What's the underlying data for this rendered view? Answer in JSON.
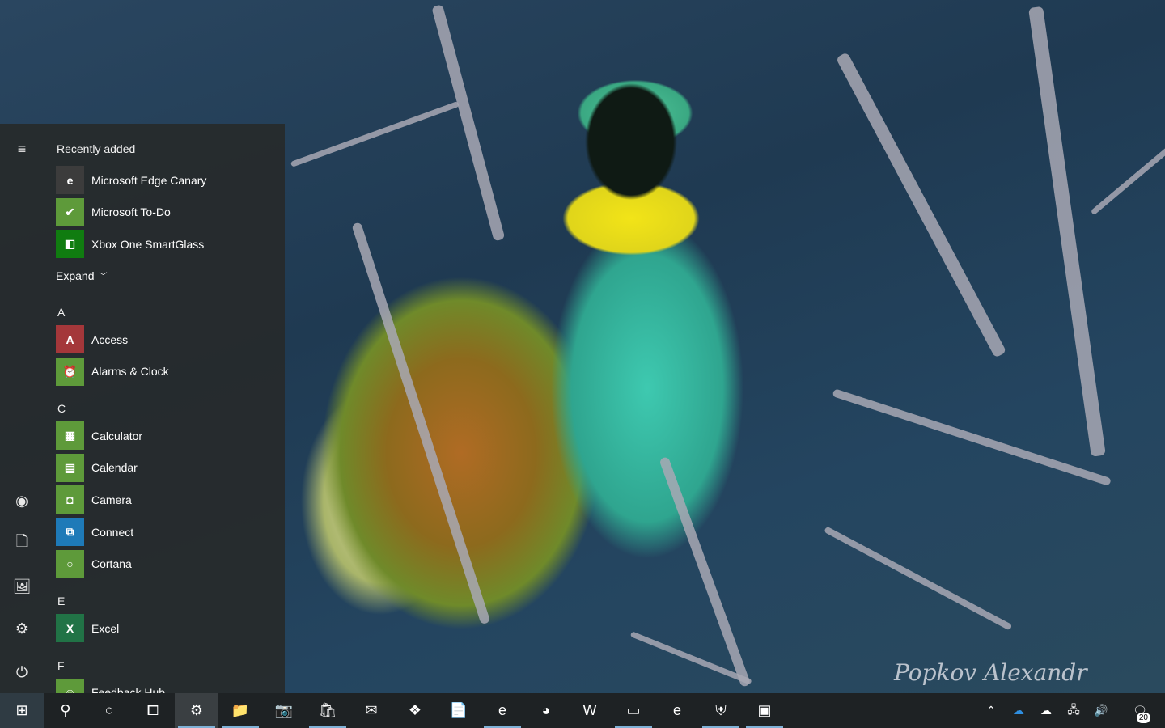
{
  "wallpaper": {
    "watermark": "Popkov Alexandr"
  },
  "start_menu": {
    "rail": {
      "items": [
        {
          "name": "hamburger-menu-icon",
          "glyph": "≡"
        },
        {
          "name": "user-avatar-icon",
          "glyph": "◉"
        },
        {
          "name": "documents-icon",
          "glyph": "🗋"
        },
        {
          "name": "pictures-icon",
          "glyph": "🖼"
        },
        {
          "name": "settings-gear-icon",
          "glyph": "⚙"
        },
        {
          "name": "power-icon",
          "glyph": "⏻"
        }
      ]
    },
    "recently_added_label": "Recently added",
    "recently_added": [
      {
        "label": "Microsoft Edge Canary",
        "icon": "edge-canary-icon",
        "color": "#3c3c3c",
        "glyph": "e"
      },
      {
        "label": "Microsoft To-Do",
        "icon": "todo-check-icon",
        "color": "#5e9a3a",
        "glyph": "✔"
      },
      {
        "label": "Xbox One SmartGlass",
        "icon": "xbox-smartglass-icon",
        "color": "#107c10",
        "glyph": "◧"
      }
    ],
    "expand_label": "Expand",
    "sections": [
      {
        "letter": "A",
        "apps": [
          {
            "label": "Access",
            "icon": "access-icon",
            "color": "#a4373a",
            "glyph": "A"
          },
          {
            "label": "Alarms & Clock",
            "icon": "alarm-clock-icon",
            "color": "#5e9a3a",
            "glyph": "⏰"
          }
        ]
      },
      {
        "letter": "C",
        "apps": [
          {
            "label": "Calculator",
            "icon": "calculator-icon",
            "color": "#5e9a3a",
            "glyph": "▦"
          },
          {
            "label": "Calendar",
            "icon": "calendar-icon",
            "color": "#5e9a3a",
            "glyph": "▤"
          },
          {
            "label": "Camera",
            "icon": "camera-icon",
            "color": "#5e9a3a",
            "glyph": "◘"
          },
          {
            "label": "Connect",
            "icon": "connect-icon",
            "color": "#1e7ab8",
            "glyph": "⧉"
          },
          {
            "label": "Cortana",
            "icon": "cortana-icon",
            "color": "#5e9a3a",
            "glyph": "○"
          }
        ]
      },
      {
        "letter": "E",
        "apps": [
          {
            "label": "Excel",
            "icon": "excel-icon",
            "color": "#217346",
            "glyph": "X"
          }
        ]
      },
      {
        "letter": "F",
        "apps": [
          {
            "label": "Feedback Hub",
            "icon": "feedback-hub-icon",
            "color": "#5e9a3a",
            "glyph": "☺"
          }
        ]
      }
    ]
  },
  "taskbar": {
    "items": [
      {
        "name": "start-button",
        "glyph": "⊞",
        "state": "start"
      },
      {
        "name": "search-icon",
        "glyph": "⚲",
        "state": ""
      },
      {
        "name": "cortana-circle-icon",
        "glyph": "○",
        "state": ""
      },
      {
        "name": "task-view-icon",
        "glyph": "⧠",
        "state": ""
      },
      {
        "name": "settings-app-icon",
        "glyph": "⚙",
        "state": "active"
      },
      {
        "name": "file-explorer-icon",
        "glyph": "📁",
        "state": "running"
      },
      {
        "name": "camera-app-icon",
        "glyph": "📷",
        "state": ""
      },
      {
        "name": "store-icon",
        "glyph": "🛍",
        "state": "running"
      },
      {
        "name": "mail-icon",
        "glyph": "✉",
        "state": ""
      },
      {
        "name": "teams-icon",
        "glyph": "❖",
        "state": ""
      },
      {
        "name": "notepad-icon",
        "glyph": "📄",
        "state": ""
      },
      {
        "name": "edge-dev-icon",
        "glyph": "e",
        "state": "running"
      },
      {
        "name": "chrome-icon",
        "glyph": "◕",
        "state": ""
      },
      {
        "name": "word-icon",
        "glyph": "W",
        "state": ""
      },
      {
        "name": "terminal-icon",
        "glyph": "▭",
        "state": "running"
      },
      {
        "name": "edge-canary-taskbar-icon",
        "glyph": "e",
        "state": ""
      },
      {
        "name": "windows-security-icon",
        "glyph": "⛨",
        "state": "running"
      },
      {
        "name": "control-panel-icon",
        "glyph": "▣",
        "state": "running"
      }
    ],
    "tray": [
      {
        "name": "show-hidden-icons-chevron-icon",
        "glyph": "⌃"
      },
      {
        "name": "onedrive-blue-icon",
        "glyph": "☁"
      },
      {
        "name": "onedrive-white-icon",
        "glyph": "☁"
      },
      {
        "name": "network-icon",
        "glyph": "🖧"
      },
      {
        "name": "volume-icon",
        "glyph": "🔊"
      }
    ],
    "notification_count": "20"
  }
}
